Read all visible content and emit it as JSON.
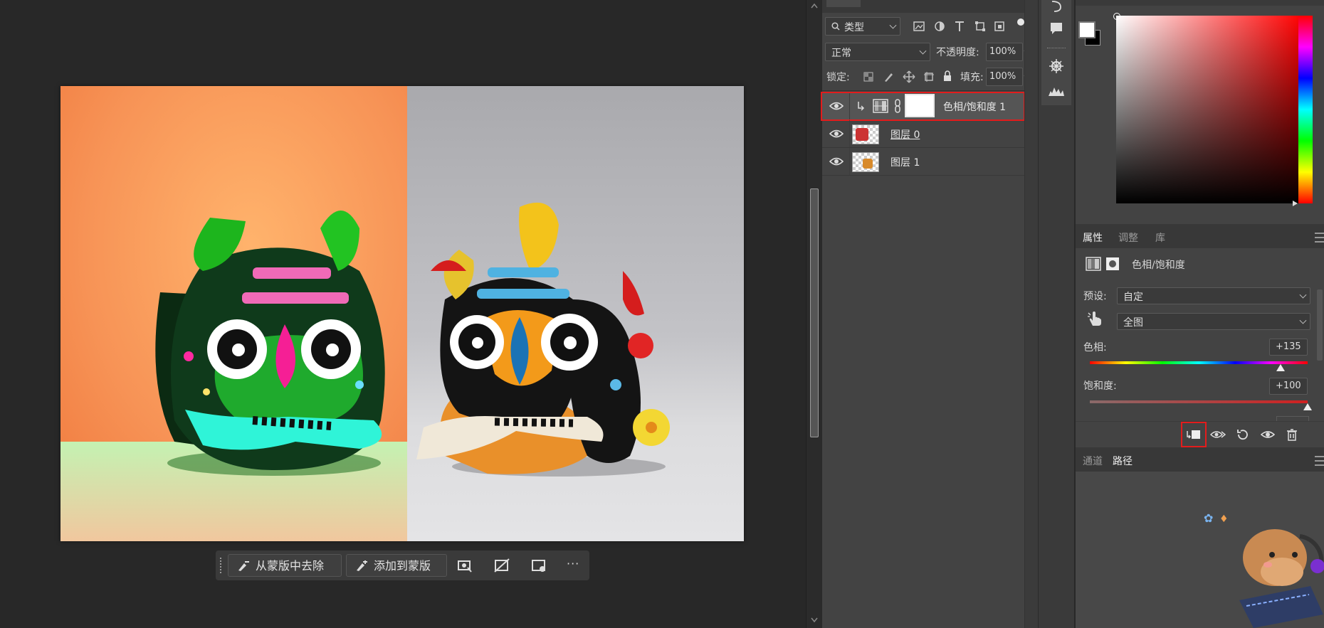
{
  "contextbar": {
    "subtract_label": "从蒙版中去除",
    "add_label": "添加到蒙版",
    "more_label": "···"
  },
  "layers": {
    "filter_label": "类型",
    "blend_mode": "正常",
    "opacity_label": "不透明度:",
    "opacity_value": "100%",
    "lock_label": "锁定:",
    "fill_label": "填充:",
    "fill_value": "100%",
    "items": [
      {
        "name": "色相/饱和度 1",
        "type": "adjustment",
        "selected": true
      },
      {
        "name": "图层 0",
        "type": "raster"
      },
      {
        "name": "图层 1",
        "type": "raster"
      }
    ]
  },
  "properties": {
    "tabs": [
      "属性",
      "调整",
      "库"
    ],
    "active_tab": "属性",
    "title": "色相/饱和度",
    "preset_label": "预设:",
    "preset_value": "自定",
    "range_value": "全图",
    "hue_label": "色相:",
    "hue_value": "+135",
    "hue_fraction": 0.875,
    "sat_label": "饱和度:",
    "sat_value": "+100",
    "sat_fraction": 1.0
  },
  "bottom_panel": {
    "tabs": [
      "通道",
      "路径"
    ],
    "active_tab": "路径"
  },
  "colors": {
    "highlight": "#e31c1c",
    "panel_bg": "#434343",
    "canvas_bg": "#282828"
  }
}
